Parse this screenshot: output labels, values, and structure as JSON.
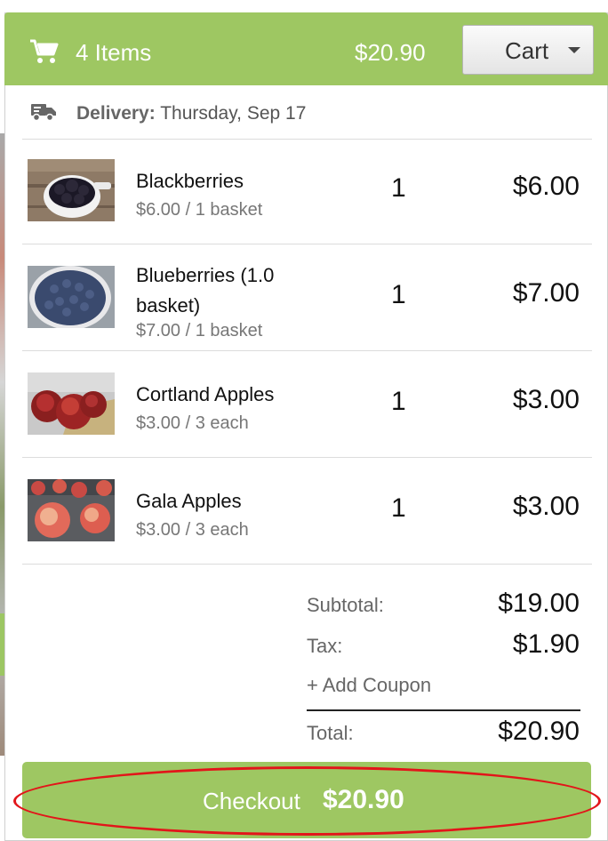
{
  "header": {
    "items_count": "4 Items",
    "total": "$20.90",
    "cart_label": "Cart",
    "icon": "cart-icon",
    "accent_color": "#9ec762"
  },
  "delivery": {
    "label": "Delivery:",
    "date": "Thursday, Sep 17",
    "icon": "truck-icon"
  },
  "items": [
    {
      "name": "Blackberries",
      "unit": "$6.00 / 1 basket",
      "qty": "1",
      "total": "$6.00"
    },
    {
      "name": "Blueberries (1.0 basket)",
      "unit": "$7.00 / 1 basket",
      "qty": "1",
      "total": "$7.00"
    },
    {
      "name": "Cortland Apples",
      "unit": "$3.00 / 3 each",
      "qty": "1",
      "total": "$3.00"
    },
    {
      "name": "Gala Apples",
      "unit": "$3.00 / 3 each",
      "qty": "1",
      "total": "$3.00"
    }
  ],
  "totals": {
    "subtotal_label": "Subtotal:",
    "subtotal": "$19.00",
    "tax_label": "Tax:",
    "tax": "$1.90",
    "coupon_label": "+ Add Coupon",
    "total_label": "Total:",
    "total": "$20.90"
  },
  "checkout": {
    "label": "Checkout",
    "amount": "$20.90",
    "highlight_color": "#e2151a"
  }
}
